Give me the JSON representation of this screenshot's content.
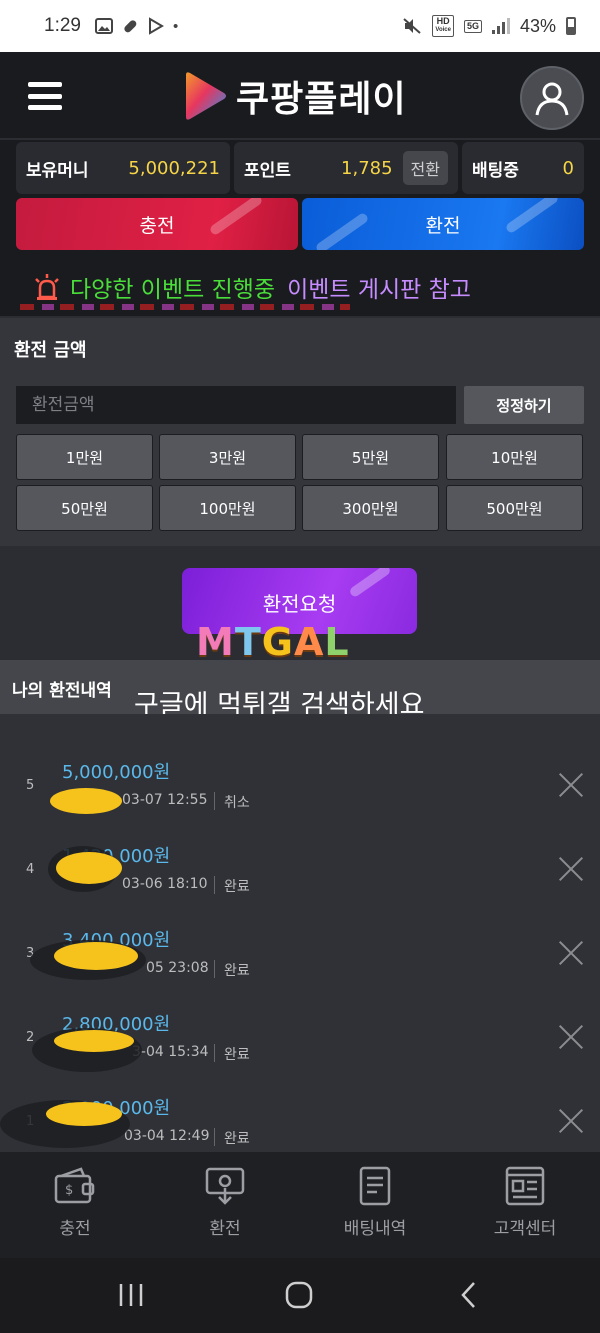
{
  "status_bar": {
    "time": "1:29",
    "battery": "43%",
    "icons": [
      "image-icon",
      "pill-icon",
      "play-store-icon",
      "dot-icon",
      "mute-icon",
      "hd-voice-icon",
      "5g-icon",
      "signal-icon",
      "battery-icon"
    ],
    "hd_label": "HD",
    "voice_label": "Voice",
    "net_label": "5G"
  },
  "header": {
    "logo_text": "쿠팡플레이",
    "menu_icon": "hamburger-icon",
    "profile_icon": "user-avatar-icon"
  },
  "balance": {
    "money_label": "보유머니",
    "money_value": "5,000,221",
    "points_label": "포인트",
    "points_value": "1,785",
    "convert_label": "전환",
    "betting_label": "배팅중",
    "betting_value": "0"
  },
  "actions": {
    "deposit_label": "충전",
    "withdraw_label": "환전"
  },
  "event_banner": {
    "icon": "siren-icon",
    "text_green": "다양한 이벤트 진행중",
    "text_purple": "이벤트 게시판 참고"
  },
  "withdraw_form": {
    "title": "환전 금액",
    "input_placeholder": "환전금액",
    "reset_label": "정정하기",
    "quick_amounts": [
      "1만원",
      "3만원",
      "5만원",
      "10만원",
      "50만원",
      "100만원",
      "300만원",
      "500만원"
    ],
    "request_label": "환전요청"
  },
  "watermark": {
    "logo_text": "MTGAL",
    "overlay_text": "구글에 먹튀갤 검색하세요"
  },
  "history": {
    "title": "나의 환전내역",
    "rows": [
      {
        "num": "5",
        "amount": "5,000,000원",
        "date": "03-07 12:55",
        "status": "취소"
      },
      {
        "num": "4",
        "amount": "1,420,000원",
        "date": "03-06 18:10",
        "status": "완료"
      },
      {
        "num": "3",
        "amount": "3,400,000원",
        "date": "05 23:08",
        "status": "완료"
      },
      {
        "num": "2",
        "amount": "2,800,000원",
        "date": "3-04 15:34",
        "status": "완료"
      },
      {
        "num": "1",
        "amount": "2,000,000원",
        "date": "03-04 12:49",
        "status": "완료"
      }
    ]
  },
  "bottom_nav": [
    {
      "label": "충전",
      "icon": "wallet-icon"
    },
    {
      "label": "환전",
      "icon": "exchange-icon"
    },
    {
      "label": "배팅내역",
      "icon": "document-icon"
    },
    {
      "label": "고객센터",
      "icon": "news-icon"
    }
  ],
  "colors": {
    "accent_yellow": "#f5d547",
    "deposit_red": "#e02045",
    "withdraw_blue": "#1a78f0",
    "request_purple": "#a83cf2",
    "amount_blue": "#5ab8ea",
    "event_green": "#4ade3a",
    "event_purple": "#c58bff"
  }
}
